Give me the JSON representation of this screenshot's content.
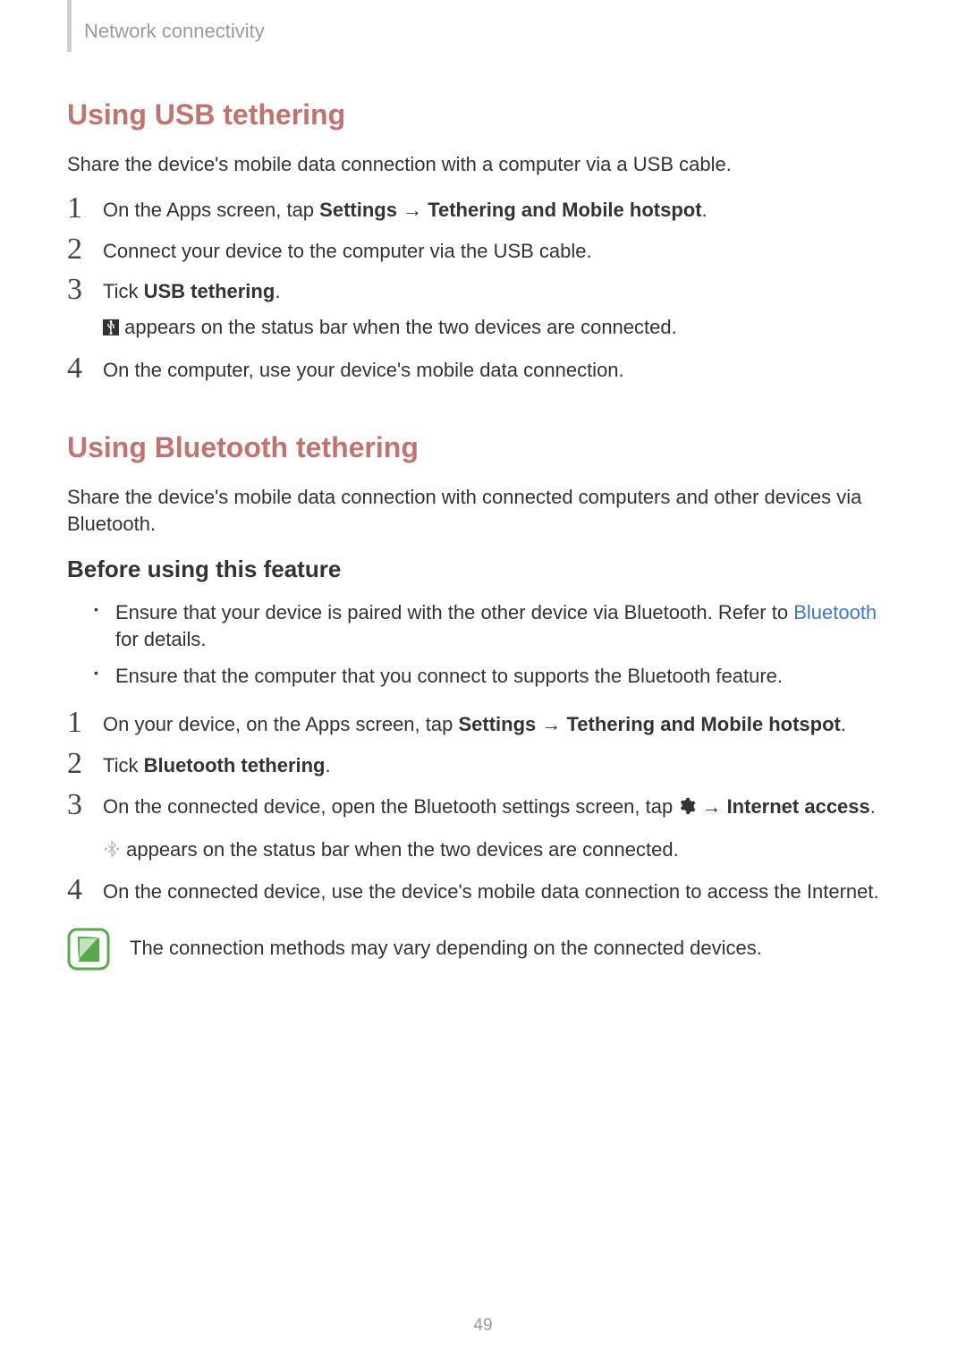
{
  "header": {
    "category": "Network connectivity"
  },
  "page_number": "49",
  "usb": {
    "title": "Using USB tethering",
    "intro": "Share the device's mobile data connection with a computer via a USB cable.",
    "steps": [
      {
        "num": "1",
        "pre": "On the Apps screen, tap ",
        "b1": "Settings",
        "arrow": " → ",
        "b2": "Tethering and Mobile hotspot",
        "post": "."
      },
      {
        "num": "2",
        "text": "Connect your device to the computer via the USB cable."
      },
      {
        "num": "3",
        "pre": "Tick ",
        "b1": "USB tethering",
        "post": ".",
        "sub_post": " appears on the status bar when the two devices are connected."
      },
      {
        "num": "4",
        "text": "On the computer, use your device's mobile data connection."
      }
    ]
  },
  "bt": {
    "title": "Using Bluetooth tethering",
    "intro": "Share the device's mobile data connection with connected computers and other devices via Bluetooth.",
    "before_title": "Before using this feature",
    "bullets": [
      {
        "pre": "Ensure that your device is paired with the other device via Bluetooth. Refer to ",
        "link": "Bluetooth",
        "post": " for details."
      },
      {
        "text": "Ensure that the computer that you connect to supports the Bluetooth feature."
      }
    ],
    "steps": [
      {
        "num": "1",
        "pre": "On your device, on the Apps screen, tap ",
        "b1": "Settings",
        "arrow": " → ",
        "b2": "Tethering and Mobile hotspot",
        "post": "."
      },
      {
        "num": "2",
        "pre": "Tick ",
        "b1": "Bluetooth tethering",
        "post": "."
      },
      {
        "num": "3",
        "pre": "On the connected device, open the Bluetooth settings screen, tap ",
        "arrow": " → ",
        "b2": "Internet access",
        "post": ".",
        "sub_post": " appears on the status bar when the two devices are connected."
      },
      {
        "num": "4",
        "text": "On the connected device, use the device's mobile data connection to access the Internet."
      }
    ],
    "note": "The connection methods may vary depending on the connected devices."
  }
}
